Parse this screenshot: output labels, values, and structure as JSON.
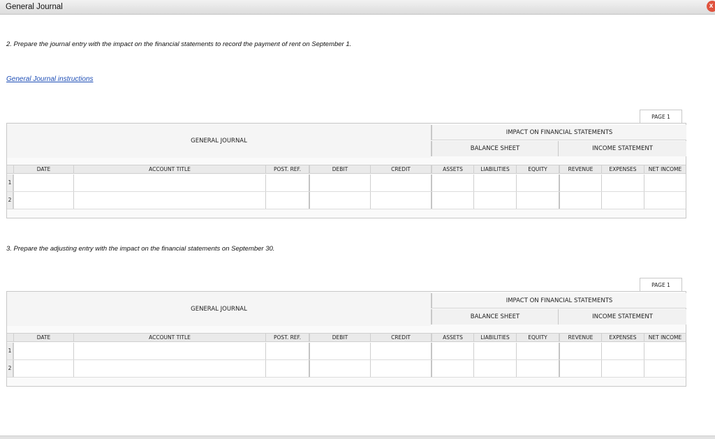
{
  "window": {
    "title": "General Journal",
    "close_label": "x"
  },
  "instruction_2": "2. Prepare the journal entry with the impact on the financial statements to record the payment of rent on September 1.",
  "instruction_3": "3. Prepare the adjusting entry with the impact on the financial statements on September 30.",
  "link_text": "General Journal instructions",
  "journals": [
    {
      "page_label": "PAGE 1",
      "heading": "GENERAL JOURNAL",
      "impact_heading": "IMPACT ON FINANCIAL STATEMENTS",
      "balance_sheet": "BALANCE SHEET",
      "income_statement": "INCOME STATEMENT",
      "columns": [
        "DATE",
        "ACCOUNT TITLE",
        "POST. REF.",
        "DEBIT",
        "CREDIT",
        "ASSETS",
        "LIABILITIES",
        "EQUITY",
        "REVENUE",
        "EXPENSES",
        "NET INCOME"
      ],
      "rows": [
        "1",
        "2"
      ]
    },
    {
      "page_label": "PAGE 1",
      "heading": "GENERAL JOURNAL",
      "impact_heading": "IMPACT ON FINANCIAL STATEMENTS",
      "balance_sheet": "BALANCE SHEET",
      "income_statement": "INCOME STATEMENT",
      "columns": [
        "DATE",
        "ACCOUNT TITLE",
        "POST. REF.",
        "DEBIT",
        "CREDIT",
        "ASSETS",
        "LIABILITIES",
        "EQUITY",
        "REVENUE",
        "EXPENSES",
        "NET INCOME"
      ],
      "rows": [
        "1",
        "2"
      ]
    }
  ]
}
